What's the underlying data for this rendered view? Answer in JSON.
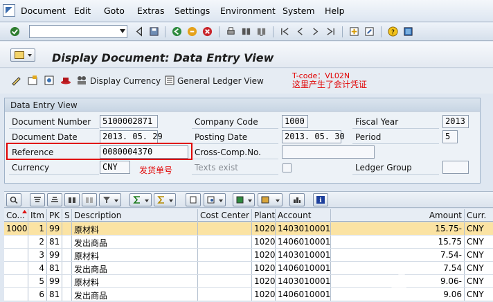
{
  "menu": [
    {
      "label": "Document",
      "u": "D"
    },
    {
      "label": "Edit",
      "u": "E"
    },
    {
      "label": "Goto",
      "u": "G"
    },
    {
      "label": "Extras",
      "u": "x"
    },
    {
      "label": "Settings",
      "u": "S"
    },
    {
      "label": "Environment",
      "u": "n"
    },
    {
      "label": "System",
      "u": "y"
    },
    {
      "label": "Help",
      "u": "H"
    }
  ],
  "title": "Display Document: Data Entry View",
  "app_toolbar": {
    "display_currency": "Display Currency",
    "general_ledger_view": "General Ledger View"
  },
  "annotations": {
    "tcode": "T-code：VL02N",
    "tcode_note": "这里产生了会计凭证",
    "delivery_note": "发货单号"
  },
  "data_entry": {
    "group_title": "Data Entry View",
    "document_number_label": "Document Number",
    "document_number": "5100002871",
    "company_code_label": "Company Code",
    "company_code": "1000",
    "fiscal_year_label": "Fiscal Year",
    "fiscal_year": "2013",
    "document_date_label": "Document Date",
    "document_date": "2013. 05. 29",
    "posting_date_label": "Posting Date",
    "posting_date": "2013. 05. 30",
    "period_label": "Period",
    "period": "5",
    "reference_label": "Reference",
    "reference": "0080004370",
    "cross_comp_label": "Cross-Comp.No.",
    "cross_comp": "",
    "currency_label": "Currency",
    "currency": "CNY",
    "texts_exist_label": "Texts exist",
    "ledger_group_label": "Ledger Group",
    "ledger_group": ""
  },
  "table": {
    "headers": {
      "co": "Co...",
      "itm": "Itm",
      "pk": "PK",
      "s": "S",
      "description": "Description",
      "cost_center": "Cost Center",
      "plant": "Plant",
      "account": "Account",
      "amount": "Amount",
      "curr": "Curr."
    },
    "rows": [
      {
        "co": "1000",
        "itm": "1",
        "pk": "99",
        "s": "",
        "description": "原材料",
        "cost_center": "",
        "plant": "1020",
        "account": "1403010001",
        "amount": "15.75-",
        "curr": "CNY"
      },
      {
        "co": "",
        "itm": "2",
        "pk": "81",
        "s": "",
        "description": "发出商品",
        "cost_center": "",
        "plant": "1020",
        "account": "1406010001",
        "amount": "15.75",
        "curr": "CNY"
      },
      {
        "co": "",
        "itm": "3",
        "pk": "99",
        "s": "",
        "description": "原材料",
        "cost_center": "",
        "plant": "1020",
        "account": "1403010001",
        "amount": "7.54-",
        "curr": "CNY"
      },
      {
        "co": "",
        "itm": "4",
        "pk": "81",
        "s": "",
        "description": "发出商品",
        "cost_center": "",
        "plant": "1020",
        "account": "1406010001",
        "amount": "7.54",
        "curr": "CNY"
      },
      {
        "co": "",
        "itm": "5",
        "pk": "99",
        "s": "",
        "description": "原材料",
        "cost_center": "",
        "plant": "1020",
        "account": "1403010001",
        "amount": "9.06-",
        "curr": "CNY"
      },
      {
        "co": "",
        "itm": "6",
        "pk": "81",
        "s": "",
        "description": "发出商品",
        "cost_center": "",
        "plant": "1020",
        "account": "1406010001",
        "amount": "9.06",
        "curr": "CNY"
      }
    ]
  },
  "colors": {
    "annotation_red": "#e00000",
    "selected_row": "#fbe3a3"
  }
}
